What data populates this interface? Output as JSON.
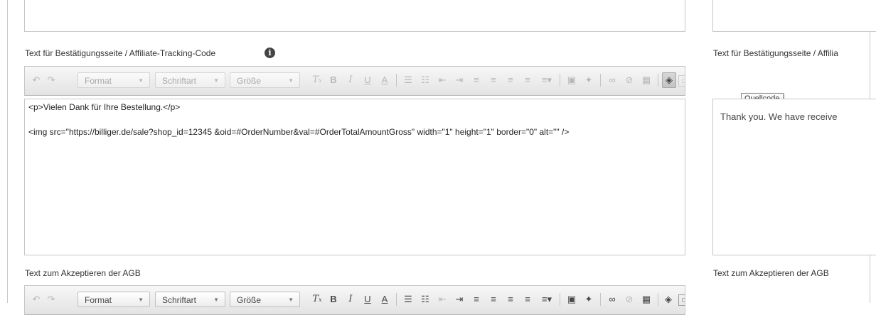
{
  "left_top_box": {},
  "right_top_box": {},
  "left_section": {
    "label": "Text für Bestätigungsseite / Affiliate-Tracking-Code",
    "info_icon": "info-icon",
    "toolbar": {
      "undo_icon": "undo-icon",
      "redo_icon": "redo-icon",
      "format": "Format",
      "font": "Schriftart",
      "size": "Größe",
      "remove_format_icon": "remove-format-icon",
      "bold": "B",
      "italic": "I",
      "underline": "U",
      "text_color": "A",
      "source_tooltip": "Quellcode"
    },
    "code_lines": [
      "<p>Vielen Dank für Ihre Bestellung.</p>",
      "<img src=\"https://billiger.de/sale?shop_id=12345 &oid=#OrderNumber&val=#OrderTotalAmountGross\" width=\"1\" height=\"1\" border=\"0\" alt=\"\" />"
    ]
  },
  "right_section": {
    "label": "Text für Bestätigungsseite / Affilia",
    "preview_text": "Thank you. We have receive"
  },
  "bottom_left": {
    "label": "Text zum Akzeptieren der AGB",
    "toolbar": {
      "format": "Format",
      "font": "Schriftart",
      "size": "Größe",
      "bold": "B",
      "italic": "I",
      "underline": "U",
      "text_color": "A"
    }
  },
  "bottom_right": {
    "label": "Text zum Akzeptieren der AGB"
  }
}
